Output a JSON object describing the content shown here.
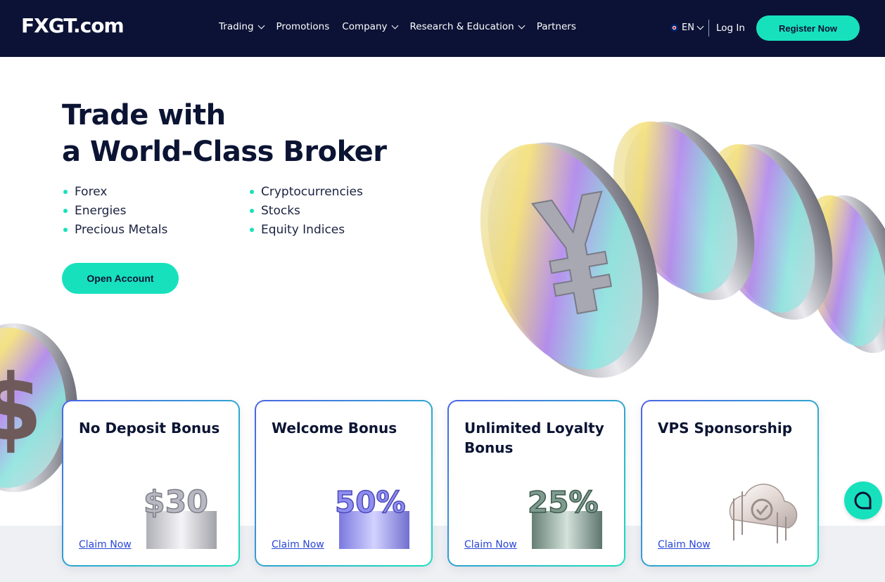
{
  "brand": {
    "logo_text": "FXGT.com"
  },
  "nav": {
    "items": [
      {
        "label": "Trading",
        "has_dropdown": true
      },
      {
        "label": "Promotions",
        "has_dropdown": false
      },
      {
        "label": "Company",
        "has_dropdown": true
      },
      {
        "label": "Research & Education",
        "has_dropdown": true
      },
      {
        "label": "Partners",
        "has_dropdown": false
      }
    ],
    "language": "EN",
    "login_label": "Log In",
    "register_label": "Register Now"
  },
  "hero": {
    "title_line1": "Trade with",
    "title_line2": "a World-Class Broker",
    "features": [
      "Forex",
      "Cryptocurrencies",
      "Energies",
      "Stocks",
      "Precious Metals",
      "Equity Indices"
    ],
    "cta_label": "Open Account"
  },
  "promos": [
    {
      "title": "No Deposit Bonus",
      "art_text": "$30",
      "link": "Claim Now"
    },
    {
      "title": "Welcome Bonus",
      "art_text": "50%",
      "link": "Claim Now"
    },
    {
      "title": "Unlimited Loyalty Bonus",
      "art_text": "25%",
      "link": "Claim Now"
    },
    {
      "title": "VPS Sponsorship",
      "art_text": "",
      "link": "Claim Now"
    }
  ],
  "colors": {
    "nav_bg": "#0b1235",
    "accent": "#17e1bd",
    "link": "#2a47d6",
    "text": "#0b1433"
  },
  "icons": {
    "chat": "chat-bubble-icon",
    "flag": "uk-flag-icon"
  }
}
